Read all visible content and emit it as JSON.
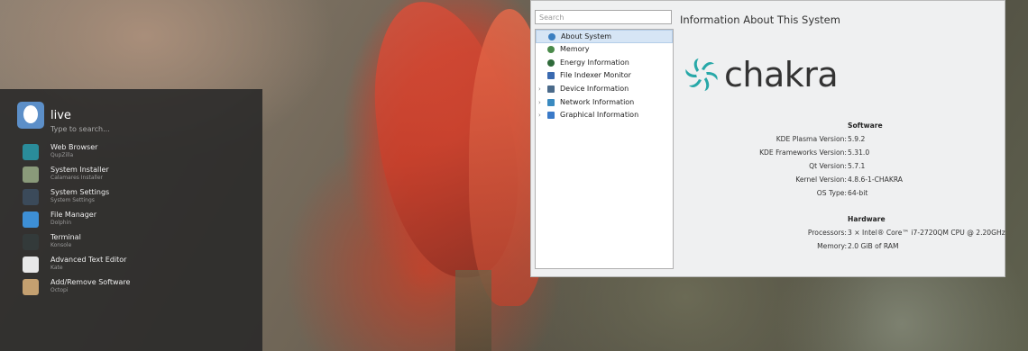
{
  "launcher": {
    "user": "live",
    "search_placeholder": "Type to search...",
    "apps": [
      {
        "name": "Web Browser",
        "sub": "QupZilla",
        "icon": "web-browser-icon",
        "color": "#2a8c9a"
      },
      {
        "name": "System Installer",
        "sub": "Calamares Installer",
        "icon": "installer-icon",
        "color": "#8a9a7a"
      },
      {
        "name": "System Settings",
        "sub": "System Settings",
        "icon": "settings-icon",
        "color": "#3b4a5a"
      },
      {
        "name": "File Manager",
        "sub": "Dolphin",
        "icon": "folder-icon",
        "color": "#3d8fd6"
      },
      {
        "name": "Terminal",
        "sub": "Konsole",
        "icon": "terminal-icon",
        "color": "#333a3a"
      },
      {
        "name": "Advanced Text Editor",
        "sub": "Kate",
        "icon": "text-editor-icon",
        "color": "#e8e8e8"
      },
      {
        "name": "Add/Remove Software",
        "sub": "Octopi",
        "icon": "package-icon",
        "color": "#c4a070"
      }
    ]
  },
  "window": {
    "search_placeholder": "Search",
    "tree": [
      {
        "label": "About System",
        "selected": true,
        "expandable": false,
        "icon": "info-icon",
        "color": "#3a7ec0"
      },
      {
        "label": "Memory",
        "selected": false,
        "expandable": false,
        "icon": "memory-icon",
        "color": "#4a8a4a"
      },
      {
        "label": "Energy Information",
        "selected": false,
        "expandable": false,
        "icon": "energy-icon",
        "color": "#2f6a3a"
      },
      {
        "label": "File Indexer Monitor",
        "selected": false,
        "expandable": false,
        "icon": "file-indexer-icon",
        "color": "#3a6ab0"
      },
      {
        "label": "Device Information",
        "selected": false,
        "expandable": true,
        "icon": "device-icon",
        "color": "#4a6a8a"
      },
      {
        "label": "Network Information",
        "selected": false,
        "expandable": true,
        "icon": "network-icon",
        "color": "#3a8ac0"
      },
      {
        "label": "Graphical Information",
        "selected": false,
        "expandable": true,
        "icon": "graphics-icon",
        "color": "#3a7ac8"
      }
    ],
    "title": "Information About This System",
    "logo_text": "chakra",
    "software": {
      "heading": "Software",
      "rows": [
        {
          "k": "KDE Plasma Version:",
          "v": "5.9.2"
        },
        {
          "k": "KDE Frameworks Version:",
          "v": "5.31.0"
        },
        {
          "k": "Qt Version:",
          "v": "5.7.1"
        },
        {
          "k": "Kernel Version:",
          "v": "4.8.6-1-CHAKRA"
        },
        {
          "k": "OS Type:",
          "v": "64-bit"
        }
      ]
    },
    "hardware": {
      "heading": "Hardware",
      "rows": [
        {
          "k": "Processors:",
          "v": "3 × Intel® Core™ i7-2720QM CPU @ 2.20GHz"
        },
        {
          "k": "Memory:",
          "v": "2.0 GiB of RAM"
        }
      ]
    }
  }
}
